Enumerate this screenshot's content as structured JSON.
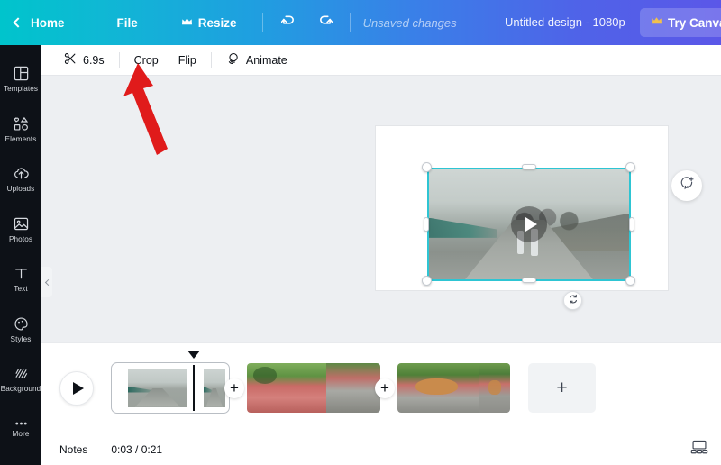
{
  "topbar": {
    "back_label": "Home",
    "back_icon": "chevron-left-icon",
    "file_label": "File",
    "resize_label": "Resize",
    "resize_icon": "crown-icon",
    "undo_icon": "undo-icon",
    "redo_icon": "redo-icon",
    "status_text": "Unsaved changes",
    "doc_title": "Untitled design - 1080p",
    "pro_label": "Try Canva Pro",
    "pro_icon": "crown-icon",
    "gradient_start": "#00c4cc",
    "gradient_end": "#5b57e8"
  },
  "sidebar": {
    "items": [
      {
        "label": "Templates",
        "icon": "templates-icon"
      },
      {
        "label": "Elements",
        "icon": "elements-icon"
      },
      {
        "label": "Uploads",
        "icon": "uploads-icon"
      },
      {
        "label": "Photos",
        "icon": "photos-icon"
      },
      {
        "label": "Text",
        "icon": "text-icon"
      },
      {
        "label": "Styles",
        "icon": "styles-icon"
      },
      {
        "label": "Background",
        "icon": "background-icon"
      },
      {
        "label": "More",
        "icon": "more-icon"
      }
    ]
  },
  "toolbar": {
    "duration_label": "6.9s",
    "duration_icon": "scissors-icon",
    "crop_label": "Crop",
    "flip_label": "Flip",
    "animate_label": "Animate",
    "animate_icon": "animate-icon"
  },
  "canvas": {
    "background_color": "#edeff2",
    "page_color": "#ffffff",
    "selection_color": "#2ec5d3",
    "play_overlay_icon": "play-icon",
    "rotate_icon": "rotate-icon",
    "comment_icon": "add-comment-icon",
    "collapse_icon": "chevron-left-icon"
  },
  "timeline": {
    "play_icon": "play-icon",
    "add_icon": "plus-icon",
    "add_page_icon": "plus-icon",
    "clips": [
      {
        "name": "clip-1",
        "selected": true
      },
      {
        "name": "clip-2",
        "selected": false
      },
      {
        "name": "clip-3",
        "selected": false
      }
    ]
  },
  "bottombar": {
    "notes_label": "Notes",
    "time_label": "0:03 / 0:21",
    "view_icon": "slideshow-view-icon"
  },
  "annotation": {
    "arrow_color": "#e01b1b",
    "arrow_target": "Crop"
  }
}
